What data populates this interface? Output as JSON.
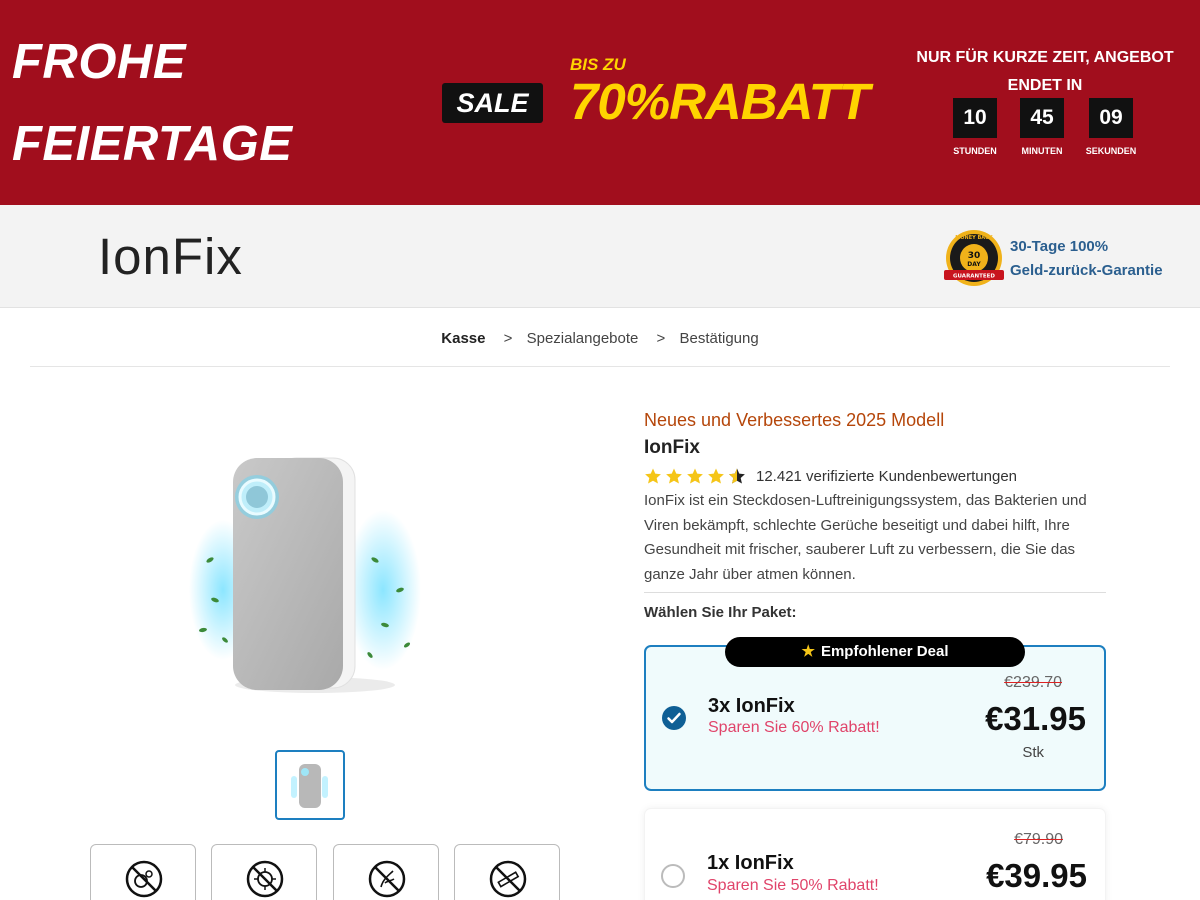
{
  "promo": {
    "title_line1": "FROHE",
    "title_line2": "FEIERTAGE",
    "sale_label": "SALE",
    "bis_zu": "BIS ZU",
    "discount": "70%RABATT",
    "countdown_heading_1": "NUR FÜR KURZE ZEIT, ANGEBOT",
    "countdown_heading_2": "ENDET IN",
    "countdown": {
      "hours": "10",
      "hours_label": "STUNDEN",
      "minutes": "45",
      "minutes_label": "MINUTEN",
      "seconds": "09",
      "seconds_label": "SEKUNDEN"
    },
    "colors": {
      "background": "#a10e1d",
      "accent": "#ffd400"
    }
  },
  "header": {
    "logo": "IonFix",
    "seal_icon": "money-back-guarantee-seal-icon",
    "seal_text_top": "MONEY BACK",
    "seal_text_mid_1": "30",
    "seal_text_mid_2": "DAY",
    "seal_text_bottom": "GUARANTEED",
    "guarantee_line1": "30-Tage 100%",
    "guarantee_line2": "Geld-zurück-Garantie"
  },
  "breadcrumb": {
    "items": [
      "Kasse",
      "Spezialangebote",
      "Bestätigung"
    ],
    "separator": ">",
    "active_index": 0
  },
  "product": {
    "subtitle": "Neues und Verbessertes 2025 Modell",
    "name": "IonFix",
    "rating": 4.5,
    "review_count": "12.421 verifizierte Kundenbewertungen",
    "description": "IonFix ist ein Steckdosen-Luftreinigungssystem, das Bakterien und Viren bekämpft, schlechte Gerüche beseitigt und dabei hilft, Ihre Gesundheit mit frischer, sauberer Luft zu verbessern, die Sie das ganze Jahr über atmen können.",
    "gallery_icons": [
      "no-germs-icon",
      "no-virus-icon",
      "no-allergens-icon",
      "no-smoke-icon"
    ]
  },
  "packages": {
    "heading": "Wählen Sie Ihr Paket:",
    "recommended_label": "Empfohlener Deal",
    "items": [
      {
        "title": "3x IonFix",
        "savings": "Sparen Sie 60% Rabatt!",
        "old_price": "€239.70",
        "price": "€31.95",
        "unit": "Stk",
        "selected": true
      },
      {
        "title": "1x IonFix",
        "savings": "Sparen Sie 50% Rabatt!",
        "old_price": "€79.90",
        "price": "€39.95",
        "selected": false
      }
    ]
  }
}
